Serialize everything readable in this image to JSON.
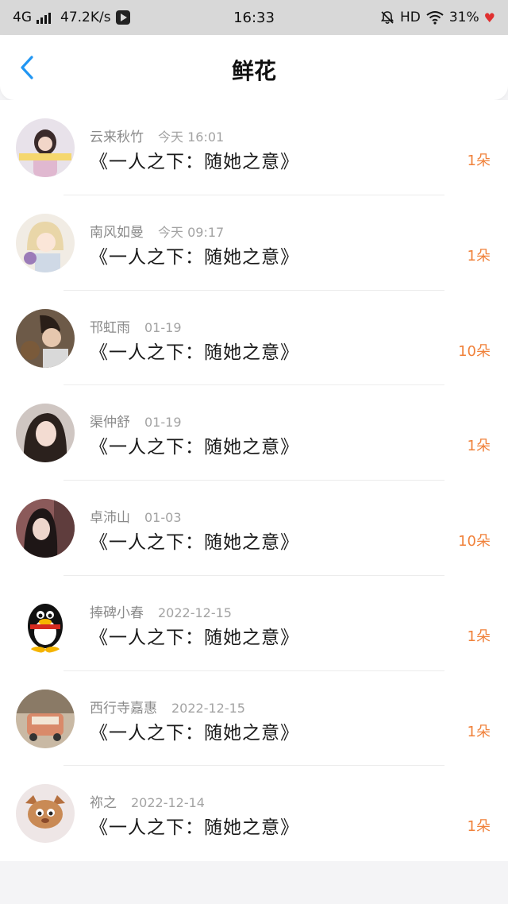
{
  "status_bar": {
    "network": "4G",
    "speed": "47.2K/s",
    "time": "16:33",
    "hd": "HD",
    "battery": "31%",
    "icons": [
      "signal-icon",
      "media-icon",
      "mute-bell-icon",
      "wifi-icon",
      "heart-icon"
    ]
  },
  "header": {
    "title": "鲜花",
    "back_icon": "chevron-left-icon",
    "accent_color": "#2196f3"
  },
  "colors": {
    "count": "#f0813a",
    "name": "#8a8a8a",
    "title": "#1a1a1a"
  },
  "items": [
    {
      "name": "云来秋竹",
      "time": "今天 16:01",
      "title": "《一人之下：随她之意》",
      "count": "1朵"
    },
    {
      "name": "南风如曼",
      "time": "今天 09:17",
      "title": "《一人之下：随她之意》",
      "count": "1朵"
    },
    {
      "name": "邗虹雨",
      "time": "01-19",
      "title": "《一人之下：随她之意》",
      "count": "10朵"
    },
    {
      "name": "渠仲舒",
      "time": "01-19",
      "title": "《一人之下：随她之意》",
      "count": "1朵"
    },
    {
      "name": "卓沛山",
      "time": "01-03",
      "title": "《一人之下：随她之意》",
      "count": "10朵"
    },
    {
      "name": "捧碑小春",
      "time": "2022-12-15",
      "title": "《一人之下：随她之意》",
      "count": "1朵"
    },
    {
      "name": "西行寺嘉惠",
      "time": "2022-12-15",
      "title": "《一人之下：随她之意》",
      "count": "1朵"
    },
    {
      "name": "祢之",
      "time": "2022-12-14",
      "title": "《一人之下：随她之意》",
      "count": "1朵"
    }
  ]
}
